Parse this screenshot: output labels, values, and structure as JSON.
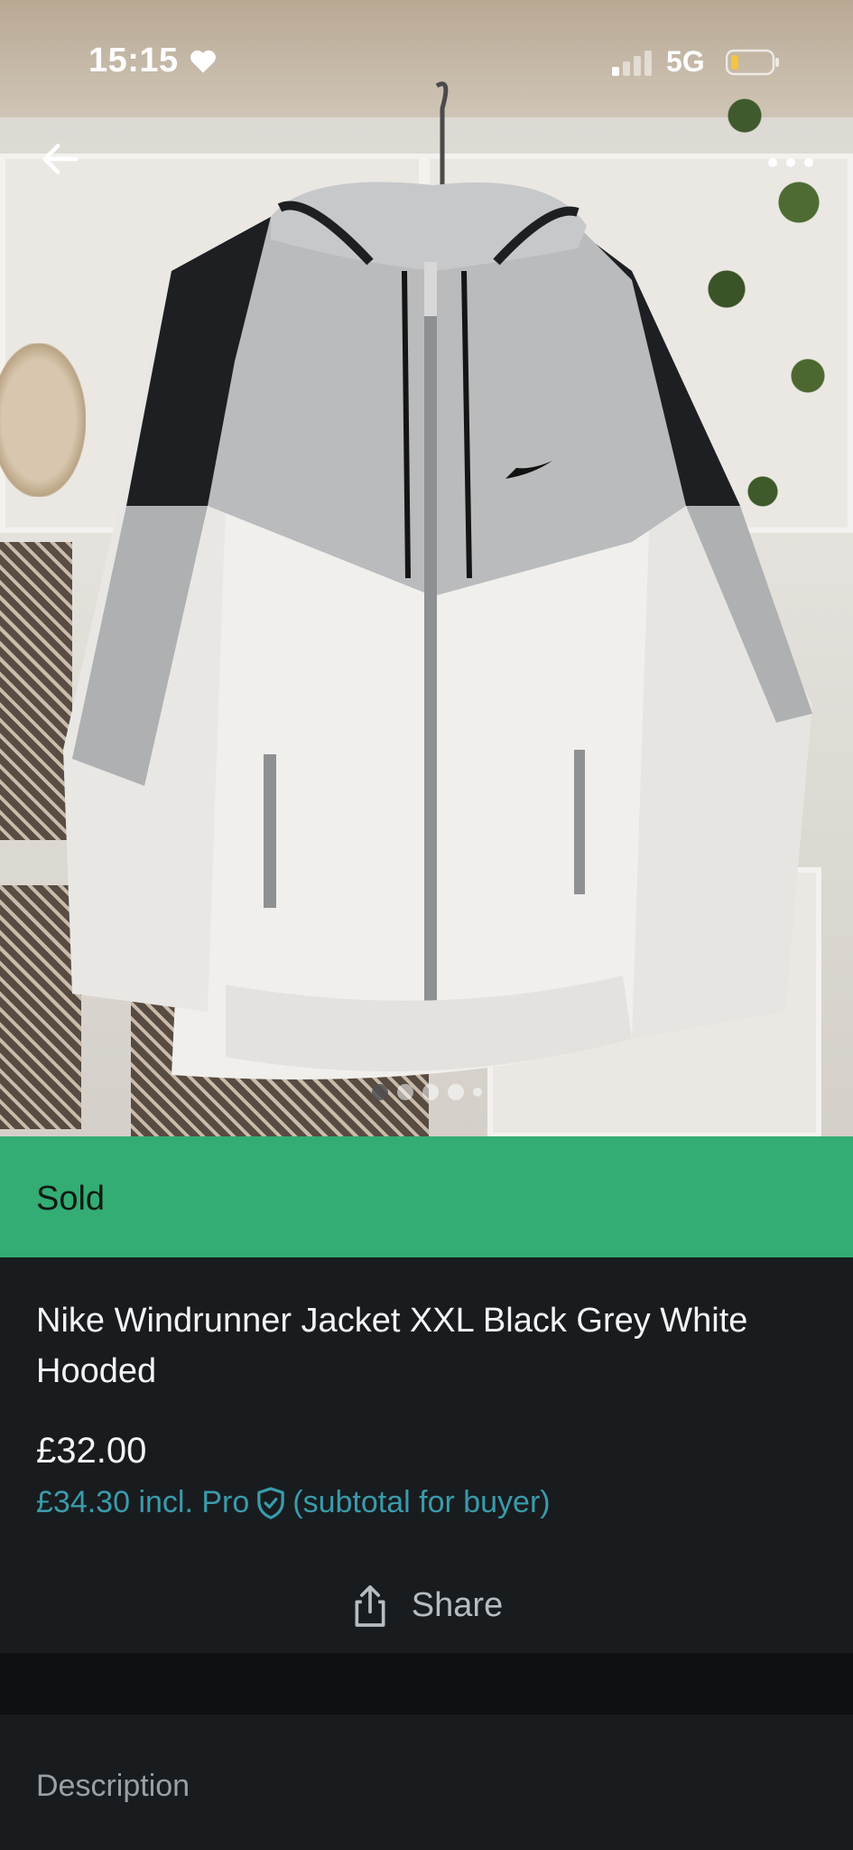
{
  "status_bar": {
    "time": "15:15",
    "network": "5G"
  },
  "listing": {
    "status": "Sold",
    "title": "Nike Windrunner Jacket XXL Black Grey White Hooded",
    "price": "£32.00",
    "price_incl": "£34.30 incl. Pro",
    "price_note": "(subtotal for buyer)",
    "share_label": "Share",
    "description_label": "Description"
  },
  "gallery": {
    "photo_count": 5,
    "active_index": 0
  },
  "colors": {
    "sold_banner": "#33ad73",
    "background": "#181c1f",
    "pro_price": "#3a9bab",
    "text_primary": "#f3f4f5",
    "text_secondary": "#9aa0a4"
  },
  "icons": {
    "back": "arrow-left-icon",
    "more": "more-horizontal-icon",
    "share": "share-icon",
    "pro": "shield-check-icon",
    "heart": "heart-icon",
    "signal": "signal-icon",
    "battery": "battery-icon"
  }
}
